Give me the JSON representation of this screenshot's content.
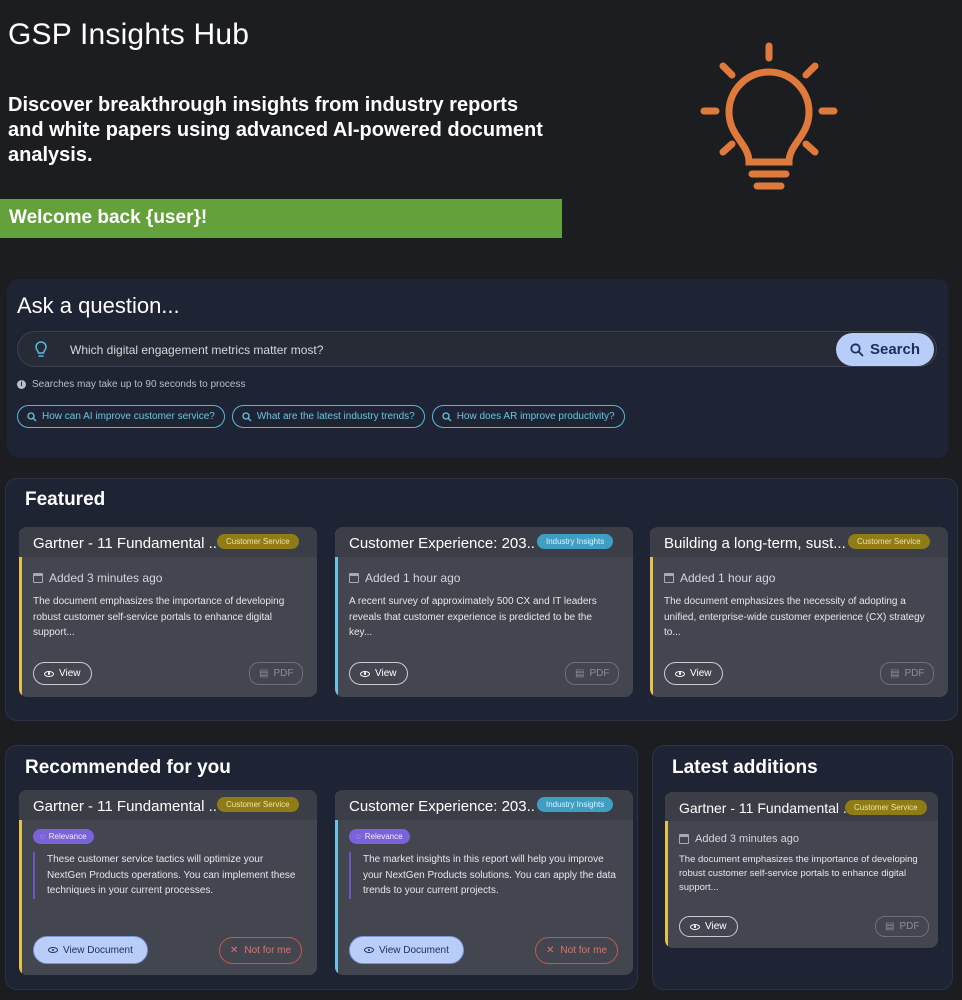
{
  "hero": {
    "title": "GSP Insights Hub",
    "subtitle": "Discover breakthrough insights from industry reports and white papers using advanced AI-powered document analysis.",
    "welcome": "Welcome back {user}!",
    "icon": "lightbulb-icon",
    "icon_color": "#e07a3a"
  },
  "ask": {
    "title": "Ask a question...",
    "search_value": "Which digital engagement metrics matter most?",
    "search_button": "Search",
    "note": "Searches may take up to 90 seconds to process",
    "chips": [
      "How can AI improve customer service?",
      "What are the latest industry trends?",
      "How does AR improve productivity?"
    ]
  },
  "featured": {
    "title": "Featured",
    "cards": [
      {
        "title": "Gartner - 11 Fundamental ...",
        "tag": "Customer Service",
        "added": "Added 3 minutes ago",
        "desc": "The document emphasizes the importance of developing robust customer self-service portals to enhance digital support...",
        "view": "View",
        "pdf": "PDF"
      },
      {
        "title": "Customer Experience: 203...",
        "tag": "Industry Insights",
        "added": "Added 1 hour ago",
        "desc": "A recent survey of approximately 500 CX and IT leaders reveals that customer experience is predicted to be the key...",
        "view": "View",
        "pdf": "PDF"
      },
      {
        "title": "Building a long-term, sust...",
        "tag": "Customer Service",
        "added": "Added 1 hour ago",
        "desc": "The document emphasizes the necessity of adopting a unified, enterprise-wide customer experience (CX) strategy to...",
        "view": "View",
        "pdf": "PDF"
      }
    ]
  },
  "recommended": {
    "title": "Recommended for you",
    "cards": [
      {
        "title": "Gartner - 11 Fundamental ...",
        "tag": "Customer Service",
        "relevance": "Relevance",
        "text": "These customer service tactics will optimize your NextGen Products operations. You can implement these techniques in your current processes.",
        "view_doc": "View Document",
        "not_for_me": "Not for me"
      },
      {
        "title": "Customer Experience: 203...",
        "tag": "Industry Insights",
        "relevance": "Relevance",
        "text": "The market insights in this report will help you improve your NextGen Products solutions. You can apply the data trends to your current projects.",
        "view_doc": "View Document",
        "not_for_me": "Not for me"
      }
    ]
  },
  "latest": {
    "title": "Latest additions",
    "card": {
      "title": "Gartner - 11 Fundamental ...",
      "tag": "Customer Service",
      "added": "Added 3 minutes ago",
      "desc": "The document emphasizes the importance of developing robust customer self-service portals to enhance digital support...",
      "view": "View",
      "pdf": "PDF"
    }
  },
  "colors": {
    "accent_yellow": "#e6c24a",
    "accent_blue": "#6cc3e6",
    "welcome_green": "#64a13b",
    "search_button": "#b8cdf8"
  }
}
